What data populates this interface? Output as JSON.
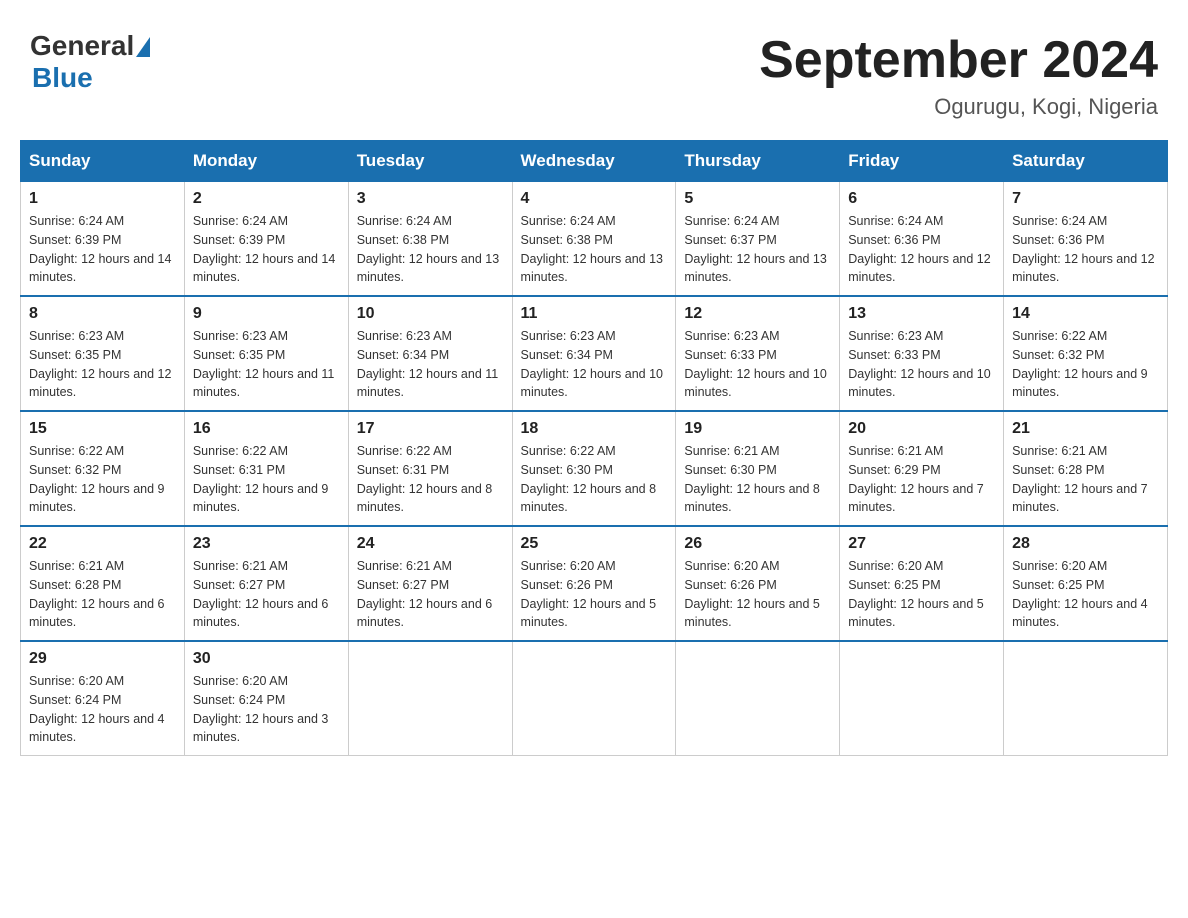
{
  "header": {
    "title": "September 2024",
    "subtitle": "Ogurugu, Kogi, Nigeria"
  },
  "weekdays": [
    "Sunday",
    "Monday",
    "Tuesday",
    "Wednesday",
    "Thursday",
    "Friday",
    "Saturday"
  ],
  "weeks": [
    [
      {
        "day": "1",
        "sunrise": "6:24 AM",
        "sunset": "6:39 PM",
        "daylight": "12 hours and 14 minutes."
      },
      {
        "day": "2",
        "sunrise": "6:24 AM",
        "sunset": "6:39 PM",
        "daylight": "12 hours and 14 minutes."
      },
      {
        "day": "3",
        "sunrise": "6:24 AM",
        "sunset": "6:38 PM",
        "daylight": "12 hours and 13 minutes."
      },
      {
        "day": "4",
        "sunrise": "6:24 AM",
        "sunset": "6:38 PM",
        "daylight": "12 hours and 13 minutes."
      },
      {
        "day": "5",
        "sunrise": "6:24 AM",
        "sunset": "6:37 PM",
        "daylight": "12 hours and 13 minutes."
      },
      {
        "day": "6",
        "sunrise": "6:24 AM",
        "sunset": "6:36 PM",
        "daylight": "12 hours and 12 minutes."
      },
      {
        "day": "7",
        "sunrise": "6:24 AM",
        "sunset": "6:36 PM",
        "daylight": "12 hours and 12 minutes."
      }
    ],
    [
      {
        "day": "8",
        "sunrise": "6:23 AM",
        "sunset": "6:35 PM",
        "daylight": "12 hours and 12 minutes."
      },
      {
        "day": "9",
        "sunrise": "6:23 AM",
        "sunset": "6:35 PM",
        "daylight": "12 hours and 11 minutes."
      },
      {
        "day": "10",
        "sunrise": "6:23 AM",
        "sunset": "6:34 PM",
        "daylight": "12 hours and 11 minutes."
      },
      {
        "day": "11",
        "sunrise": "6:23 AM",
        "sunset": "6:34 PM",
        "daylight": "12 hours and 10 minutes."
      },
      {
        "day": "12",
        "sunrise": "6:23 AM",
        "sunset": "6:33 PM",
        "daylight": "12 hours and 10 minutes."
      },
      {
        "day": "13",
        "sunrise": "6:23 AM",
        "sunset": "6:33 PM",
        "daylight": "12 hours and 10 minutes."
      },
      {
        "day": "14",
        "sunrise": "6:22 AM",
        "sunset": "6:32 PM",
        "daylight": "12 hours and 9 minutes."
      }
    ],
    [
      {
        "day": "15",
        "sunrise": "6:22 AM",
        "sunset": "6:32 PM",
        "daylight": "12 hours and 9 minutes."
      },
      {
        "day": "16",
        "sunrise": "6:22 AM",
        "sunset": "6:31 PM",
        "daylight": "12 hours and 9 minutes."
      },
      {
        "day": "17",
        "sunrise": "6:22 AM",
        "sunset": "6:31 PM",
        "daylight": "12 hours and 8 minutes."
      },
      {
        "day": "18",
        "sunrise": "6:22 AM",
        "sunset": "6:30 PM",
        "daylight": "12 hours and 8 minutes."
      },
      {
        "day": "19",
        "sunrise": "6:21 AM",
        "sunset": "6:30 PM",
        "daylight": "12 hours and 8 minutes."
      },
      {
        "day": "20",
        "sunrise": "6:21 AM",
        "sunset": "6:29 PM",
        "daylight": "12 hours and 7 minutes."
      },
      {
        "day": "21",
        "sunrise": "6:21 AM",
        "sunset": "6:28 PM",
        "daylight": "12 hours and 7 minutes."
      }
    ],
    [
      {
        "day": "22",
        "sunrise": "6:21 AM",
        "sunset": "6:28 PM",
        "daylight": "12 hours and 6 minutes."
      },
      {
        "day": "23",
        "sunrise": "6:21 AM",
        "sunset": "6:27 PM",
        "daylight": "12 hours and 6 minutes."
      },
      {
        "day": "24",
        "sunrise": "6:21 AM",
        "sunset": "6:27 PM",
        "daylight": "12 hours and 6 minutes."
      },
      {
        "day": "25",
        "sunrise": "6:20 AM",
        "sunset": "6:26 PM",
        "daylight": "12 hours and 5 minutes."
      },
      {
        "day": "26",
        "sunrise": "6:20 AM",
        "sunset": "6:26 PM",
        "daylight": "12 hours and 5 minutes."
      },
      {
        "day": "27",
        "sunrise": "6:20 AM",
        "sunset": "6:25 PM",
        "daylight": "12 hours and 5 minutes."
      },
      {
        "day": "28",
        "sunrise": "6:20 AM",
        "sunset": "6:25 PM",
        "daylight": "12 hours and 4 minutes."
      }
    ],
    [
      {
        "day": "29",
        "sunrise": "6:20 AM",
        "sunset": "6:24 PM",
        "daylight": "12 hours and 4 minutes."
      },
      {
        "day": "30",
        "sunrise": "6:20 AM",
        "sunset": "6:24 PM",
        "daylight": "12 hours and 3 minutes."
      },
      null,
      null,
      null,
      null,
      null
    ]
  ]
}
